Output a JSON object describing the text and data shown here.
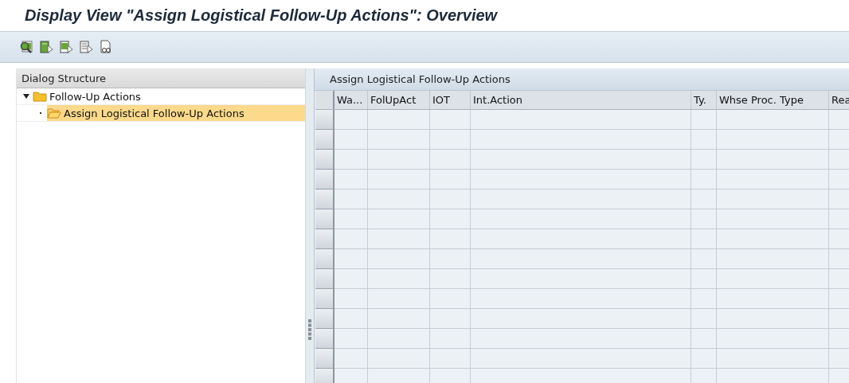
{
  "window": {
    "title": "Display View \"Assign Logistical Follow-Up Actions\": Overview"
  },
  "dialog_structure": {
    "title": "Dialog Structure",
    "items": [
      {
        "label": "Follow-Up Actions",
        "expanded": true,
        "selected": false,
        "children": [
          {
            "label": "Assign Logistical Follow-Up Actions",
            "selected": true
          }
        ]
      }
    ]
  },
  "table": {
    "title": "Assign Logistical Follow-Up Actions",
    "columns": [
      "Wa...",
      "FolUpAct",
      "IOT",
      "Int.Action",
      "Ty.",
      "Whse Proc. Type",
      "Rea"
    ]
  }
}
